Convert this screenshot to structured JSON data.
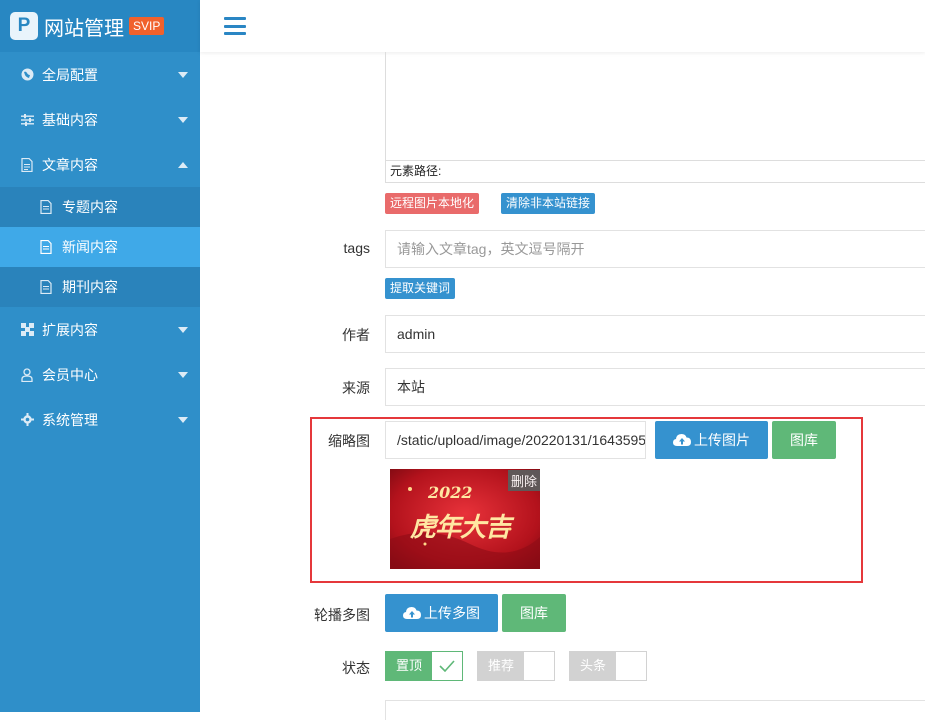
{
  "brand": {
    "logo_letter": "P",
    "title": "网站管理",
    "badge": "SVIP"
  },
  "sidebar": {
    "items": [
      {
        "label": "全局配置",
        "icon": "globe-icon",
        "expanded": false
      },
      {
        "label": "基础内容",
        "icon": "sliders-icon",
        "expanded": false
      },
      {
        "label": "文章内容",
        "icon": "document-icon",
        "expanded": true,
        "children": [
          {
            "label": "专题内容",
            "active": false
          },
          {
            "label": "新闻内容",
            "active": true
          },
          {
            "label": "期刊内容",
            "active": false
          }
        ]
      },
      {
        "label": "扩展内容",
        "icon": "puzzle-icon",
        "expanded": false
      },
      {
        "label": "会员中心",
        "icon": "user-icon",
        "expanded": false
      },
      {
        "label": "系统管理",
        "icon": "gear-icon",
        "expanded": false
      }
    ]
  },
  "editor": {
    "path_label": "元素路径:",
    "remote_btn": "远程图片本地化",
    "clear_btn": "清除非本站链接"
  },
  "form": {
    "tags": {
      "label": "tags",
      "placeholder": "请输入文章tag，英文逗号隔开",
      "extract_btn": "提取关键词"
    },
    "author": {
      "label": "作者",
      "value": "admin"
    },
    "source": {
      "label": "来源",
      "value": "本站"
    },
    "thumbnail": {
      "label": "缩略图",
      "value": "/static/upload/image/20220131/1643595",
      "upload_btn": "上传图片",
      "gallery_btn": "图库",
      "delete_label": "删除",
      "image_text": "虎年大吉",
      "image_subtext": "2022"
    },
    "carousel": {
      "label": "轮播多图",
      "upload_btn": "上传多图",
      "gallery_btn": "图库"
    },
    "status": {
      "label": "状态",
      "switches": [
        {
          "label": "置顶",
          "on": true
        },
        {
          "label": "推荐",
          "on": false
        },
        {
          "label": "头条",
          "on": false
        }
      ]
    }
  },
  "colors": {
    "sidebar": "#2f8fc9",
    "accent_blue": "#3592cf",
    "green": "#5fb878",
    "red": "#e5383b",
    "badge": "#f0612c"
  }
}
